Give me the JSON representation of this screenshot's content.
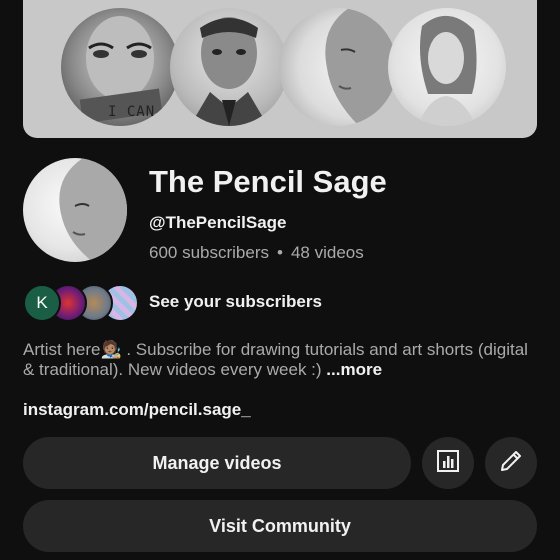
{
  "banner": {
    "artwork_text": "I CAN"
  },
  "channel": {
    "name": "The Pencil Sage",
    "handle": "@ThePencilSage",
    "subscribers": "600 subscribers",
    "separator": "•",
    "videos": "48 videos"
  },
  "subscribers_preview": {
    "first_initial": "K",
    "label": "See your subscribers"
  },
  "description": {
    "text": "Artist here🧑🏽‍🎨 . Subscribe for drawing tutorials and art shorts (digital & traditional). New videos every week :) ",
    "more_label": "...more"
  },
  "link": "instagram.com/pencil.sage_",
  "buttons": {
    "manage_videos": "Manage videos",
    "visit_community": "Visit Community"
  },
  "icons": {
    "analytics": "bar-chart-icon",
    "edit": "pencil-icon"
  }
}
